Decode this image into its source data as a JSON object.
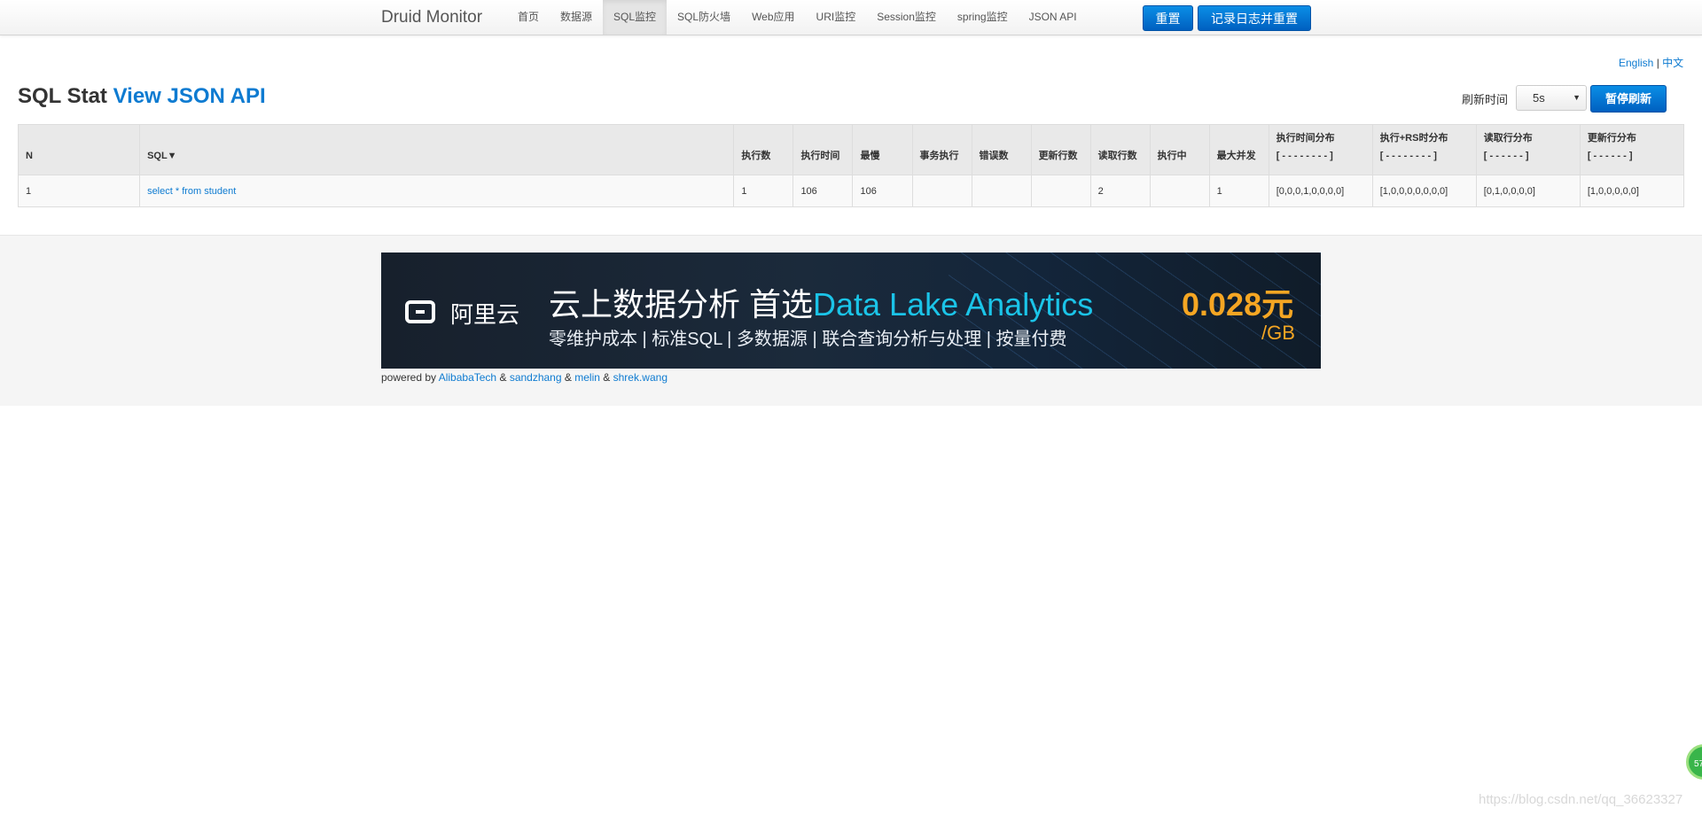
{
  "navbar": {
    "brand": "Druid Monitor",
    "items": [
      "首页",
      "数据源",
      "SQL监控",
      "SQL防火墙",
      "Web应用",
      "URI监控",
      "Session监控",
      "spring监控",
      "JSON API"
    ],
    "active_index": 2,
    "reset_button": "重置",
    "log_reset_button": "记录日志并重置"
  },
  "lang": {
    "english": "English",
    "separator": "|",
    "chinese": "中文"
  },
  "page": {
    "title_prefix": "SQL Stat",
    "title_link": "View JSON API",
    "refresh_label": "刷新时间",
    "refresh_value": "5s",
    "pause_button": "暂停刷新"
  },
  "table": {
    "headers": {
      "n": "N",
      "sql": "SQL▼",
      "exec_count": "执行数",
      "exec_time": "执行时间",
      "slowest": "最慢",
      "tx_exec": "事务执行",
      "errors": "错误数",
      "update_rows": "更新行数",
      "read_rows": "读取行数",
      "running": "执行中",
      "max_concurrent": "最大并发",
      "exec_hist": "执行时间分布",
      "exec_hist_sub": "[ - - - - - - - - ]",
      "exec_rs_hist": "执行+RS时分布",
      "exec_rs_hist_sub": "[ - - - - - - - - ]",
      "read_hist": "读取行分布",
      "read_hist_sub": "[ - - - - - - ]",
      "update_hist": "更新行分布",
      "update_hist_sub": "[ - - - - - - ]"
    },
    "rows": [
      {
        "n": "1",
        "sql": "select * from student",
        "exec_count": "1",
        "exec_time": "106",
        "slowest": "106",
        "tx_exec": "",
        "errors": "",
        "update_rows": "",
        "read_rows": "2",
        "running": "",
        "max_concurrent": "1",
        "exec_hist": "[0,0,0,1,0,0,0,0]",
        "exec_rs_hist": "[1,0,0,0,0,0,0,0]",
        "read_hist": "[0,1,0,0,0,0]",
        "update_hist": "[1,0,0,0,0,0]"
      }
    ]
  },
  "banner": {
    "logo_text": "阿里云",
    "headline_cn": "云上数据分析 首选",
    "headline_en": "Data Lake Analytics",
    "subtitle": "零维护成本 | 标准SQL | 多数据源 | 联合查询分析与处理 | 按量付费",
    "price": "0.028元",
    "unit": "/GB"
  },
  "footer": {
    "powered_by": "powered by",
    "author1": "AlibabaTech",
    "amp": "&",
    "author2": "sandzhang",
    "author3": "melin",
    "author4": "shrek.wang"
  },
  "corner_badge": "57",
  "watermark": "https://blog.csdn.net/qq_36623327",
  "colors": {
    "link": "#0e7bd1",
    "primary_button": "#0a7ad9",
    "banner_accent": "#1bc4e8",
    "price": "#f5a623"
  }
}
